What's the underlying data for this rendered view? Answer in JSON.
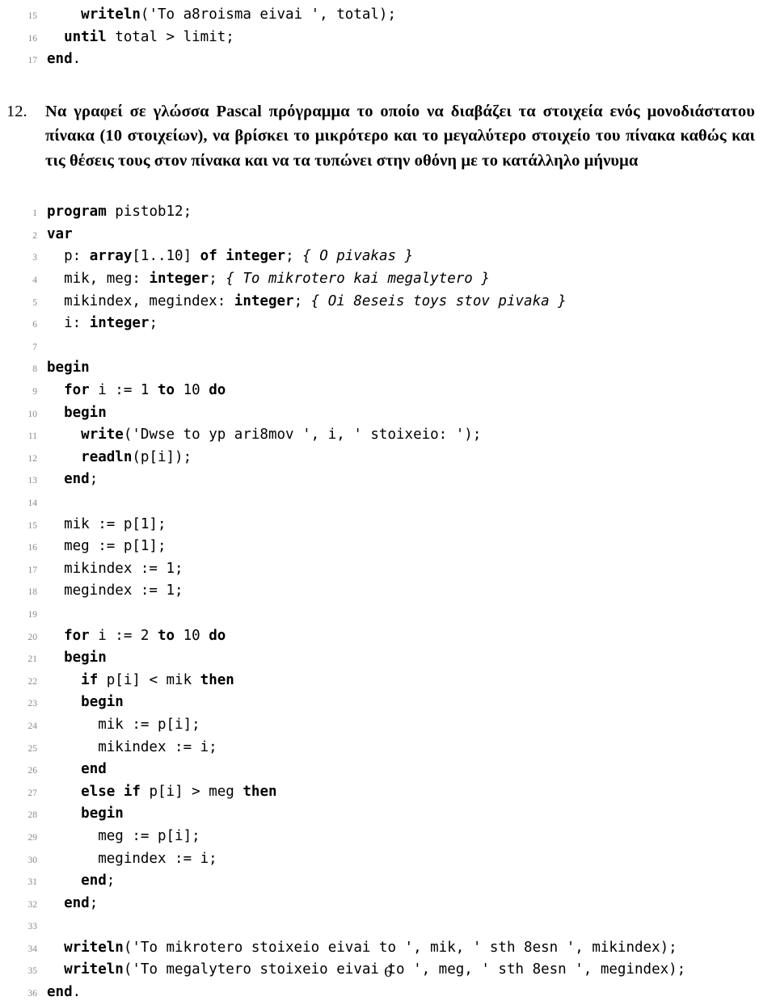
{
  "page": {
    "number": "6"
  },
  "top_listing": {
    "lines": [
      {
        "no": "15",
        "segments": [
          {
            "text": "    ",
            "style": "pl"
          },
          {
            "text": "writeln",
            "style": "kw"
          },
          {
            "text": "('To a8roisma eivai ', total);",
            "style": "pl"
          }
        ]
      },
      {
        "no": "16",
        "segments": [
          {
            "text": "  ",
            "style": "pl"
          },
          {
            "text": "until",
            "style": "kw"
          },
          {
            "text": " total > limit;",
            "style": "pl"
          }
        ]
      },
      {
        "no": "17",
        "segments": [
          {
            "text": "end",
            "style": "kw"
          },
          {
            "text": ".",
            "style": "pl"
          }
        ]
      }
    ]
  },
  "exercise": {
    "number": "12.",
    "text": "Να γραφεί σε γλώσσα Pascal πρόγραμμα το οποίο να διαβάζει τα στοιχεία ενός μονοδιάστατου πίνακα (10 στοιχείων), να βρίσκει το μικρότερο και το μεγαλύτερο στοιχείο του πίνακα καθώς και τις θέσεις τους στον πίνακα και να τα τυπώνει στην οθόνη με το κατάλληλο μήνυμα"
  },
  "main_listing": {
    "lines": [
      {
        "no": "1",
        "segments": [
          {
            "text": "program",
            "style": "kw"
          },
          {
            "text": " pistob12;",
            "style": "pl"
          }
        ]
      },
      {
        "no": "2",
        "segments": [
          {
            "text": "var",
            "style": "kw"
          }
        ]
      },
      {
        "no": "3",
        "segments": [
          {
            "text": "  p: ",
            "style": "pl"
          },
          {
            "text": "array",
            "style": "kw"
          },
          {
            "text": "[1..10] ",
            "style": "pl"
          },
          {
            "text": "of",
            "style": "kw"
          },
          {
            "text": " ",
            "style": "pl"
          },
          {
            "text": "integer",
            "style": "kw"
          },
          {
            "text": "; ",
            "style": "pl"
          },
          {
            "text": "{ O pivakas }",
            "style": "cmt"
          }
        ]
      },
      {
        "no": "4",
        "segments": [
          {
            "text": "  mik, meg: ",
            "style": "pl"
          },
          {
            "text": "integer",
            "style": "kw"
          },
          {
            "text": "; ",
            "style": "pl"
          },
          {
            "text": "{ To mikrotero kai megalytero }",
            "style": "cmt"
          }
        ]
      },
      {
        "no": "5",
        "segments": [
          {
            "text": "  mikindex, megindex: ",
            "style": "pl"
          },
          {
            "text": "integer",
            "style": "kw"
          },
          {
            "text": "; ",
            "style": "pl"
          },
          {
            "text": "{ Oi 8eseis toys stov pivaka }",
            "style": "cmt"
          }
        ]
      },
      {
        "no": "6",
        "segments": [
          {
            "text": "  i: ",
            "style": "pl"
          },
          {
            "text": "integer",
            "style": "kw"
          },
          {
            "text": ";",
            "style": "pl"
          }
        ]
      },
      {
        "no": "7",
        "segments": []
      },
      {
        "no": "8",
        "segments": [
          {
            "text": "begin",
            "style": "kw"
          }
        ]
      },
      {
        "no": "9",
        "segments": [
          {
            "text": "  ",
            "style": "pl"
          },
          {
            "text": "for",
            "style": "kw"
          },
          {
            "text": " i := 1 ",
            "style": "pl"
          },
          {
            "text": "to",
            "style": "kw"
          },
          {
            "text": " 10 ",
            "style": "pl"
          },
          {
            "text": "do",
            "style": "kw"
          }
        ]
      },
      {
        "no": "10",
        "segments": [
          {
            "text": "  ",
            "style": "pl"
          },
          {
            "text": "begin",
            "style": "kw"
          }
        ]
      },
      {
        "no": "11",
        "segments": [
          {
            "text": "    ",
            "style": "pl"
          },
          {
            "text": "write",
            "style": "kw"
          },
          {
            "text": "('Dwse to yp ari8mov ', i, ' stoixeio: ');",
            "style": "pl"
          }
        ]
      },
      {
        "no": "12",
        "segments": [
          {
            "text": "    ",
            "style": "pl"
          },
          {
            "text": "readln",
            "style": "kw"
          },
          {
            "text": "(p[i]);",
            "style": "pl"
          }
        ]
      },
      {
        "no": "13",
        "segments": [
          {
            "text": "  ",
            "style": "pl"
          },
          {
            "text": "end",
            "style": "kw"
          },
          {
            "text": ";",
            "style": "pl"
          }
        ]
      },
      {
        "no": "14",
        "segments": []
      },
      {
        "no": "15",
        "segments": [
          {
            "text": "  mik := p[1];",
            "style": "pl"
          }
        ]
      },
      {
        "no": "16",
        "segments": [
          {
            "text": "  meg := p[1];",
            "style": "pl"
          }
        ]
      },
      {
        "no": "17",
        "segments": [
          {
            "text": "  mikindex := 1;",
            "style": "pl"
          }
        ]
      },
      {
        "no": "18",
        "segments": [
          {
            "text": "  megindex := 1;",
            "style": "pl"
          }
        ]
      },
      {
        "no": "19",
        "segments": []
      },
      {
        "no": "20",
        "segments": [
          {
            "text": "  ",
            "style": "pl"
          },
          {
            "text": "for",
            "style": "kw"
          },
          {
            "text": " i := 2 ",
            "style": "pl"
          },
          {
            "text": "to",
            "style": "kw"
          },
          {
            "text": " 10 ",
            "style": "pl"
          },
          {
            "text": "do",
            "style": "kw"
          }
        ]
      },
      {
        "no": "21",
        "segments": [
          {
            "text": "  ",
            "style": "pl"
          },
          {
            "text": "begin",
            "style": "kw"
          }
        ]
      },
      {
        "no": "22",
        "segments": [
          {
            "text": "    ",
            "style": "pl"
          },
          {
            "text": "if",
            "style": "kw"
          },
          {
            "text": " p[i] < mik ",
            "style": "pl"
          },
          {
            "text": "then",
            "style": "kw"
          }
        ]
      },
      {
        "no": "23",
        "segments": [
          {
            "text": "    ",
            "style": "pl"
          },
          {
            "text": "begin",
            "style": "kw"
          }
        ]
      },
      {
        "no": "24",
        "segments": [
          {
            "text": "      mik := p[i];",
            "style": "pl"
          }
        ]
      },
      {
        "no": "25",
        "segments": [
          {
            "text": "      mikindex := i;",
            "style": "pl"
          }
        ]
      },
      {
        "no": "26",
        "segments": [
          {
            "text": "    ",
            "style": "pl"
          },
          {
            "text": "end",
            "style": "kw"
          }
        ]
      },
      {
        "no": "27",
        "segments": [
          {
            "text": "    ",
            "style": "pl"
          },
          {
            "text": "else",
            "style": "kw"
          },
          {
            "text": " ",
            "style": "pl"
          },
          {
            "text": "if",
            "style": "kw"
          },
          {
            "text": " p[i] > meg ",
            "style": "pl"
          },
          {
            "text": "then",
            "style": "kw"
          }
        ]
      },
      {
        "no": "28",
        "segments": [
          {
            "text": "    ",
            "style": "pl"
          },
          {
            "text": "begin",
            "style": "kw"
          }
        ]
      },
      {
        "no": "29",
        "segments": [
          {
            "text": "      meg := p[i];",
            "style": "pl"
          }
        ]
      },
      {
        "no": "30",
        "segments": [
          {
            "text": "      megindex := i;",
            "style": "pl"
          }
        ]
      },
      {
        "no": "31",
        "segments": [
          {
            "text": "    ",
            "style": "pl"
          },
          {
            "text": "end",
            "style": "kw"
          },
          {
            "text": ";",
            "style": "pl"
          }
        ]
      },
      {
        "no": "32",
        "segments": [
          {
            "text": "  ",
            "style": "pl"
          },
          {
            "text": "end",
            "style": "kw"
          },
          {
            "text": ";",
            "style": "pl"
          }
        ]
      },
      {
        "no": "33",
        "segments": []
      },
      {
        "no": "34",
        "segments": [
          {
            "text": "  ",
            "style": "pl"
          },
          {
            "text": "writeln",
            "style": "kw"
          },
          {
            "text": "('To mikrotero stoixeio eivai to ', mik, ' sth 8esn ', mikindex);",
            "style": "pl"
          }
        ]
      },
      {
        "no": "35",
        "segments": [
          {
            "text": "  ",
            "style": "pl"
          },
          {
            "text": "writeln",
            "style": "kw"
          },
          {
            "text": "('To megalytero stoixeio eivai to ', meg, ' sth 8esn ', megindex);",
            "style": "pl"
          }
        ]
      },
      {
        "no": "36",
        "segments": [
          {
            "text": "end",
            "style": "kw"
          },
          {
            "text": ".",
            "style": "pl"
          }
        ]
      }
    ]
  }
}
